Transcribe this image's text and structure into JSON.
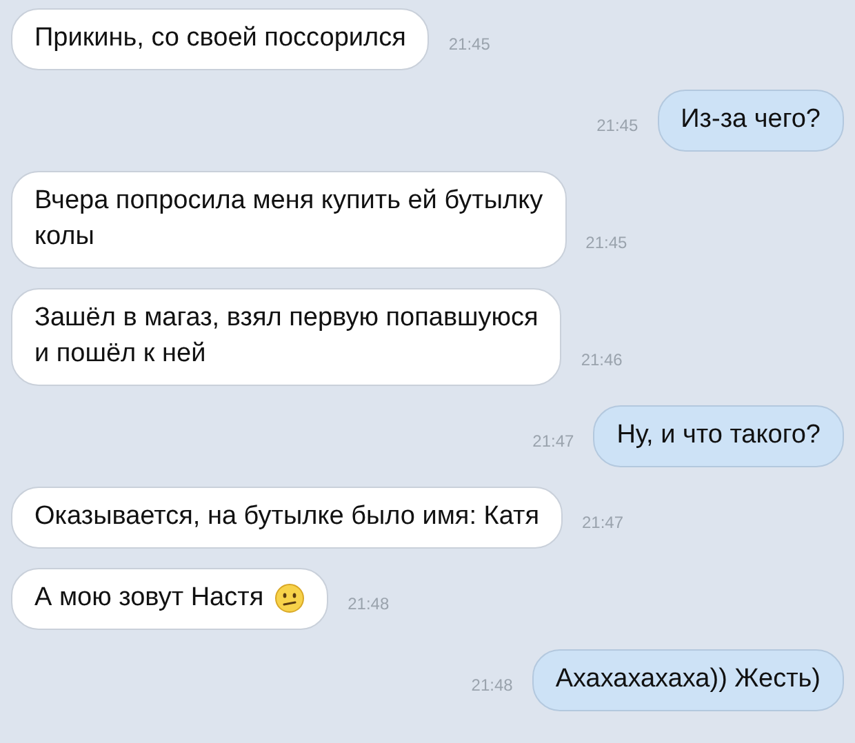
{
  "messages": [
    {
      "kind": "incoming",
      "lines": [
        "Прикинь, со своей поссорился"
      ],
      "time": "21:45",
      "emoji": false
    },
    {
      "kind": "outgoing",
      "lines": [
        "Из-за чего?"
      ],
      "time": "21:45",
      "emoji": false
    },
    {
      "kind": "incoming",
      "lines": [
        "Вчера попросила меня купить ей бутылку",
        "колы"
      ],
      "time": "21:45",
      "emoji": false
    },
    {
      "kind": "incoming",
      "lines": [
        "Зашёл в магаз, взял первую попавшуюся",
        "и пошёл к ней"
      ],
      "time": "21:46",
      "emoji": false
    },
    {
      "kind": "outgoing",
      "lines": [
        "Ну, и что такого?"
      ],
      "time": "21:47",
      "emoji": false
    },
    {
      "kind": "incoming",
      "lines": [
        "Оказывается, на бутылке было имя: Катя"
      ],
      "time": "21:47",
      "emoji": false
    },
    {
      "kind": "incoming",
      "lines": [
        "А мою зовут Настя"
      ],
      "time": "21:48",
      "emoji": true
    },
    {
      "kind": "outgoing",
      "lines": [
        "Ахахахахаха)) Жесть)"
      ],
      "time": "21:48",
      "emoji": false
    }
  ]
}
